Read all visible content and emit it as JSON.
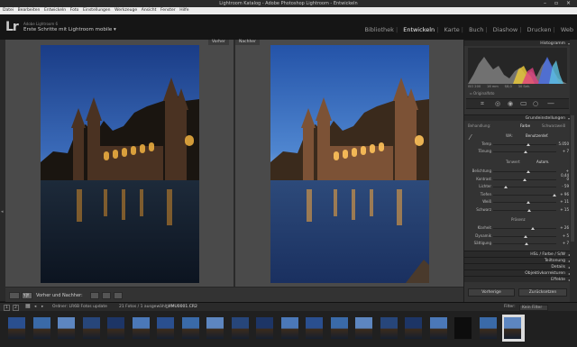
{
  "window": {
    "title": "Lightroom Katalog - Adobe Photoshop Lightroom - Entwickeln",
    "controls": [
      "–",
      "▫",
      "×"
    ]
  },
  "menu": [
    "Datei",
    "Bearbeiten",
    "Entwickeln",
    "Foto",
    "Einstellungen",
    "Werkzeuge",
    "Ansicht",
    "Fenster",
    "Hilfe"
  ],
  "identity": {
    "logo": "Lr",
    "app_name": "Adobe Lightroom 6",
    "catalog_title": "Erste Schritte mit Lightroom mobile ▾"
  },
  "modules": [
    {
      "label": "Bibliothek",
      "active": false
    },
    {
      "label": "Entwickeln",
      "active": true
    },
    {
      "label": "Karte",
      "active": false
    },
    {
      "label": "Buch",
      "active": false
    },
    {
      "label": "Diashow",
      "active": false
    },
    {
      "label": "Drucken",
      "active": false
    },
    {
      "label": "Web",
      "active": false
    }
  ],
  "compare": {
    "before_label": "Vorher",
    "after_label": "Nachher"
  },
  "toolbar": {
    "view_mode_label": "Y|Y",
    "compare_label": "Vorher und Nachher:"
  },
  "right_panel": {
    "histogram_title": "Histogramm",
    "histogram_info": [
      "ISO 200",
      "16 mm",
      "f/8,0",
      "30 Sek."
    ],
    "original_photo_label": "Originalfoto",
    "basic_title": "Grundeinstellungen",
    "treatment_label": "Behandlung:",
    "treatment_color": "Farbe",
    "treatment_bw": "Schwarzweiß",
    "wb_label": "WA:",
    "wb_value": "Benutzerdef.",
    "tone_label": "Tonwert",
    "tone_auto": "Autom.",
    "presence_label": "Präsenz",
    "hsl_label": "HSL / Farbe / S/W",
    "sections": [
      "Teiltonung",
      "Details",
      "Objektivkorrekturen",
      "Effekte"
    ],
    "sliders_wb": [
      {
        "label": "Temp",
        "value": "5.050",
        "pos": 0.55
      },
      {
        "label": "Tönung",
        "value": "+ 7",
        "pos": 0.52
      }
    ],
    "sliders_tone": [
      {
        "label": "Belichtung",
        "value": "+ 0,44",
        "pos": 0.55
      },
      {
        "label": "Kontrast",
        "value": "0",
        "pos": 0.5
      },
      {
        "label": "Lichter",
        "value": "- 59",
        "pos": 0.2
      },
      {
        "label": "Tiefen",
        "value": "+ 96",
        "pos": 0.97
      },
      {
        "label": "Weiß",
        "value": "+ 11",
        "pos": 0.55
      },
      {
        "label": "Schwarz",
        "value": "+ 15",
        "pos": 0.57
      }
    ],
    "sliders_presence": [
      {
        "label": "Klarheit",
        "value": "+ 26",
        "pos": 0.63
      },
      {
        "label": "Dynamik",
        "value": "+ 5",
        "pos": 0.52
      },
      {
        "label": "Sättigung",
        "value": "+ 7",
        "pos": 0.53
      }
    ],
    "prev_button": "Vorherige",
    "reset_button": "Zurücksetzen"
  },
  "filmstrip_info": {
    "pages": [
      "1",
      "2"
    ],
    "source": "Ordner: LR6B Fotos update",
    "count": "21 Fotos / 1 ausgewählt /",
    "filename": "_HMU0001.CR2",
    "filter_label": "Filter:",
    "filter_value": "Kein Filter"
  },
  "filmstrip": {
    "count": 21,
    "selected_index": 20
  },
  "colors": {
    "accent": "#e9e9e9",
    "panel_bg": "#333333",
    "canvas_bg": "#4a4a4a"
  }
}
